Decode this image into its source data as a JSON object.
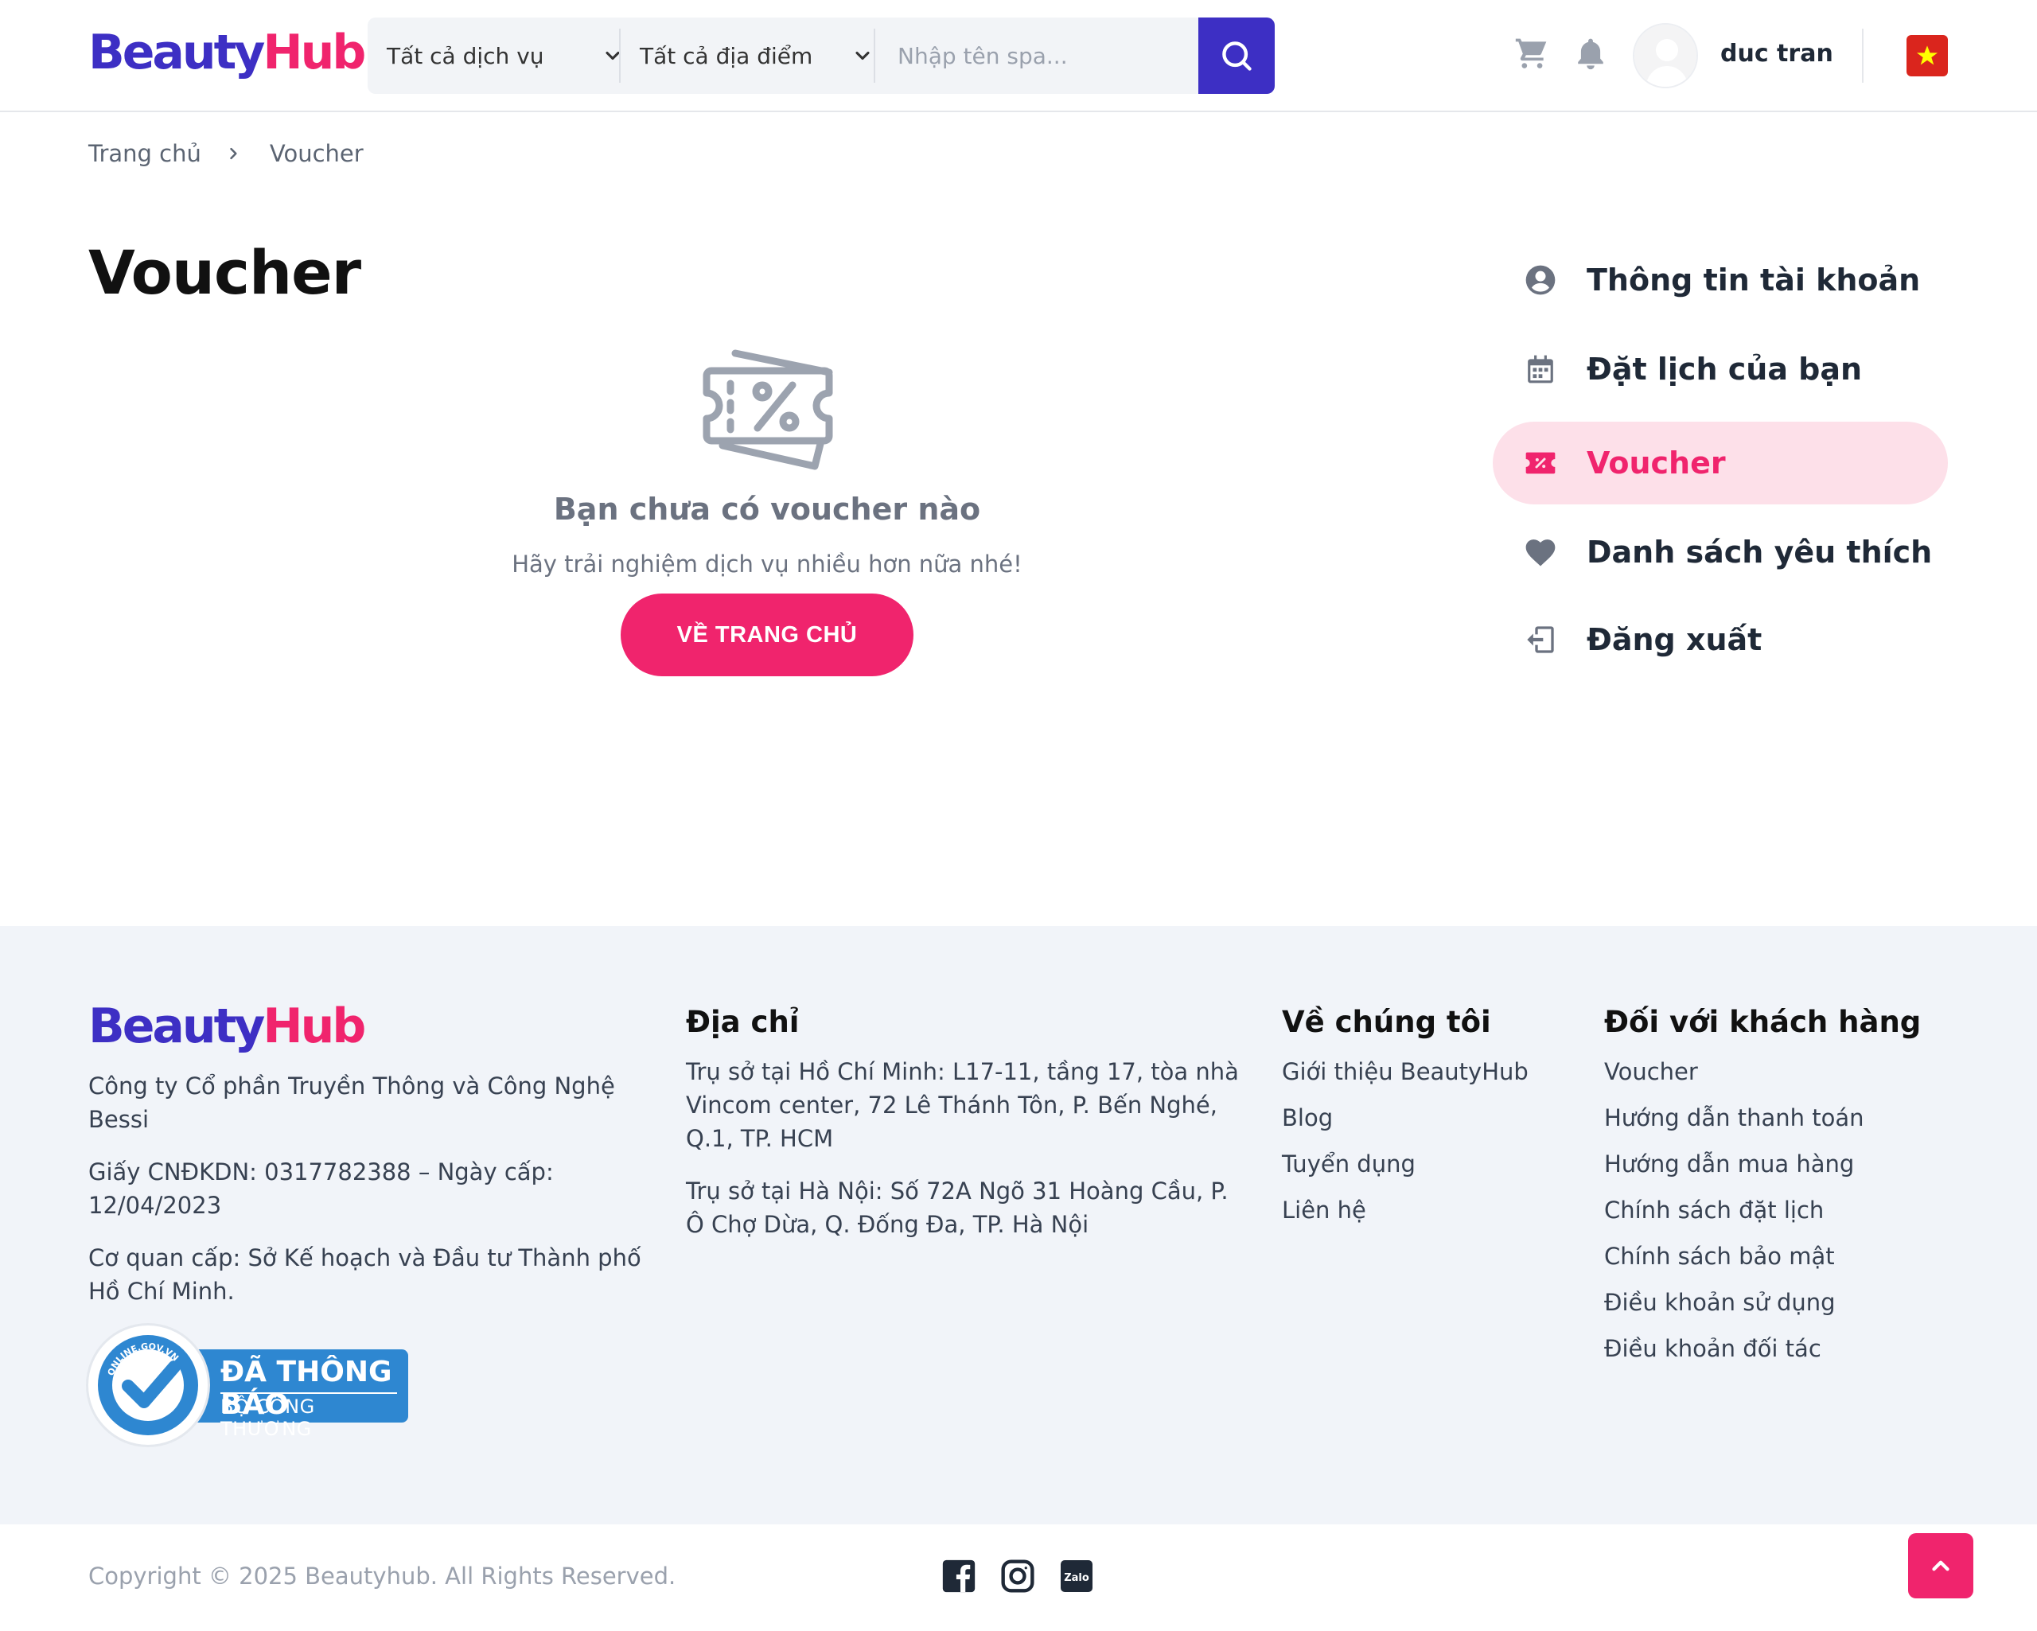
{
  "brand": {
    "logo_part1": "Beauty",
    "logo_part2": "Hub"
  },
  "colors": {
    "primary": "#3d2fc4",
    "accent": "#f0246d",
    "accent_soft": "#fde0e9",
    "footer_bg": "#f1f4f9",
    "icon_gray": "#6b7280"
  },
  "header": {
    "service_select": "Tất cả dịch vụ",
    "place_select": "Tất cả địa điểm",
    "search_placeholder": "Nhập tên spa...",
    "icons": [
      "cart-icon",
      "bell-icon",
      "search-icon",
      "vietnam-flag-icon"
    ],
    "user_name": "duc tran"
  },
  "breadcrumb": {
    "home": "Trang chủ",
    "current": "Voucher"
  },
  "main": {
    "title": "Voucher",
    "empty_title": "Bạn chưa có voucher nào",
    "empty_subtitle": "Hãy trải nghiệm dịch vụ nhiều hơn nữa nhé!",
    "home_button": "VỀ TRANG CHỦ"
  },
  "side_menu": {
    "items": [
      {
        "label": "Thông tin tài khoản",
        "icon": "user-circle-icon",
        "active": false
      },
      {
        "label": "Đặt lịch của bạn",
        "icon": "calendar-icon",
        "active": false
      },
      {
        "label": "Voucher",
        "icon": "voucher-icon",
        "active": true
      },
      {
        "label": "Danh sách yêu thích",
        "icon": "heart-icon",
        "active": false
      },
      {
        "label": "Đăng xuất",
        "icon": "logout-icon",
        "active": false
      }
    ]
  },
  "footer": {
    "company": {
      "name": "Công ty Cổ phần Truyền Thông và Công Nghệ Bessi",
      "license": "Giấy CNĐKDN: 0317782388 – Ngày cấp: 12/04/2023",
      "issuer": "Cơ quan cấp: Sở Kế hoạch và Đầu tư Thành phố Hồ Chí Minh."
    },
    "address": {
      "heading": "Địa chỉ",
      "hcm": "Trụ sở tại Hồ Chí Minh: L17-11, tầng 17, tòa nhà Vincom center, 72 Lê Thánh Tôn, P. Bến Nghé, Q.1, TP. HCM",
      "hanoi": "Trụ sở tại Hà Nội: Số 72A Ngõ 31 Hoàng Cầu, P. Ô Chợ Dừa, Q. Đống Đa, TP. Hà Nội"
    },
    "about": {
      "heading": "Về chúng tôi",
      "links": [
        "Giới thiệu BeautyHub",
        "Blog",
        "Tuyển dụng",
        "Liên hệ"
      ]
    },
    "customer": {
      "heading": "Đối với khách hàng",
      "links": [
        "Voucher",
        "Hướng dẫn thanh toán",
        "Hướng dẫn mua hàng",
        "Chính sách đặt lịch",
        "Chính sách bảo mật",
        "Điều khoản sử dụng",
        "Điều khoản đối tác"
      ]
    },
    "gov_badge": {
      "ring_text": "ONLINE.GOV.VN",
      "line1": "ĐÃ THÔNG BÁO",
      "line2": "BỘ CÔNG THƯƠNG"
    },
    "copyright": "Copyright © 2025 Beautyhub. All Rights Reserved.",
    "social": [
      "facebook-icon",
      "instagram-icon",
      "zalo-icon"
    ],
    "zalo_label": "Zalo"
  }
}
